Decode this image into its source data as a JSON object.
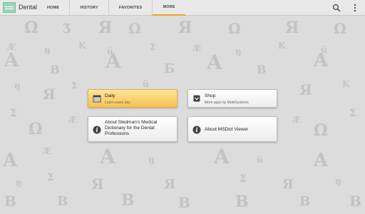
{
  "app": {
    "title": "Dental"
  },
  "tabs": [
    {
      "label": "HOME",
      "active": false
    },
    {
      "label": "HISTORY",
      "active": false
    },
    {
      "label": "FAVORITES",
      "active": false
    },
    {
      "label": "MORE",
      "active": true
    }
  ],
  "toolbar": {
    "search_icon": "search-icon",
    "overflow_icon": "overflow-menu-icon"
  },
  "cards": {
    "daily": {
      "title": "Daily",
      "subtitle": "Learn every day",
      "icon": "calendar-icon"
    },
    "shop": {
      "title": "Shop",
      "subtitle": "More apps by MobiSystems",
      "icon": "shop-bag-icon"
    },
    "about_dictionary": {
      "title": "About Stedman's Medical Dictionary for the Dental Professions",
      "icon": "info-icon"
    },
    "about_viewer": {
      "title": "About MSDict Viewer",
      "icon": "info-icon"
    }
  },
  "colors": {
    "accent": "#f0a51f",
    "highlight": "#f6c34e",
    "background": "#dcdcdc"
  }
}
